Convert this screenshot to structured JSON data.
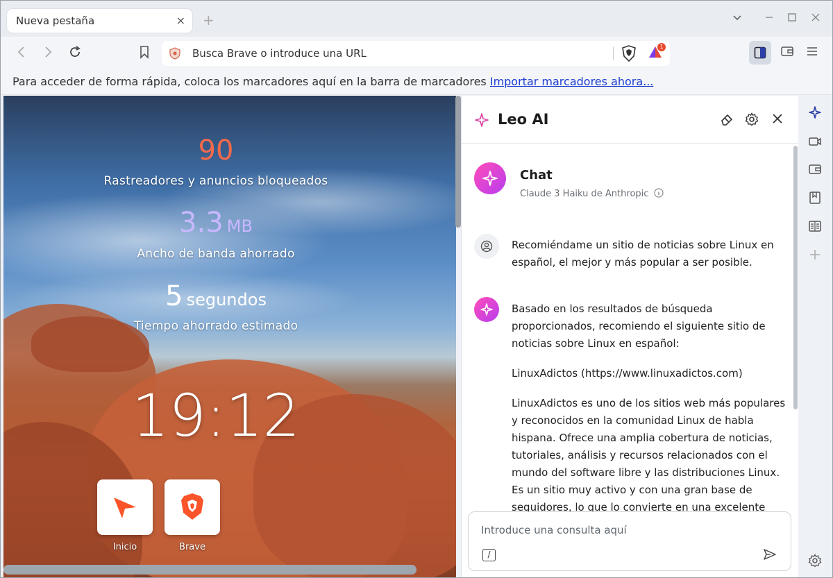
{
  "tab": {
    "title": "Nueva pestaña",
    "close": "×",
    "new_tab": "+"
  },
  "window_controls": {
    "dropdown": "⌄",
    "minimize": "–",
    "maximize": "☐",
    "close": "✕"
  },
  "toolbar": {
    "url_placeholder": "Busca Brave o introduce una URL",
    "rewards_badge": "1"
  },
  "bookmarks_bar": {
    "text": "Para acceder de forma rápida, coloca los marcadores aquí en la barra de marcadores",
    "link": "Importar marcadores ahora..."
  },
  "ntp": {
    "stats": [
      {
        "value": "90",
        "unit": "",
        "label": "Rastreadores y anuncios bloqueados",
        "color": "#f26a4b"
      },
      {
        "value": "3.3",
        "unit": "MB",
        "label": "Ancho de banda ahorrado",
        "color": "#c9b8ff"
      },
      {
        "value": "5",
        "unit": "segundos",
        "label": "Tiempo ahorrado estimado",
        "color": "#ffffff"
      }
    ],
    "clock": "19:12",
    "sites": [
      {
        "label": "Inicio",
        "icon": "arrow-cursor-icon"
      },
      {
        "label": "Brave",
        "icon": "brave-lion-icon"
      }
    ]
  },
  "leo": {
    "title": "Leo AI",
    "chat_title": "Chat",
    "model": "Claude 3 Haiku de Anthropic",
    "messages": [
      {
        "role": "user",
        "text": "Recomiéndame un sitio de noticias sobre Linux en español, el mejor y más popular a ser posible."
      },
      {
        "role": "assistant",
        "paragraphs": [
          "Basado en los resultados de búsqueda proporcionados, recomiendo el siguiente sitio de noticias sobre Linux en español:",
          "LinuxAdictos (https://www.linuxadictos.com)",
          "LinuxAdictos es uno de los sitios web más populares y reconocidos en la comunidad Linux de habla hispana. Ofrece una amplia cobertura de noticias, tutoriales, análisis y recursos relacionados con el mundo del software libre y las distribuciones Linux. Es un sitio muy activo y con una gran base de seguidores, lo que lo convierte en una excelente"
        ]
      }
    ],
    "composer_placeholder": "Introduce una consulta aquí",
    "slash_label": "/"
  },
  "colors": {
    "leo_gradient_start": "#ff4db8",
    "leo_gradient_end": "#b83cf0",
    "link": "#1f3fd1"
  }
}
